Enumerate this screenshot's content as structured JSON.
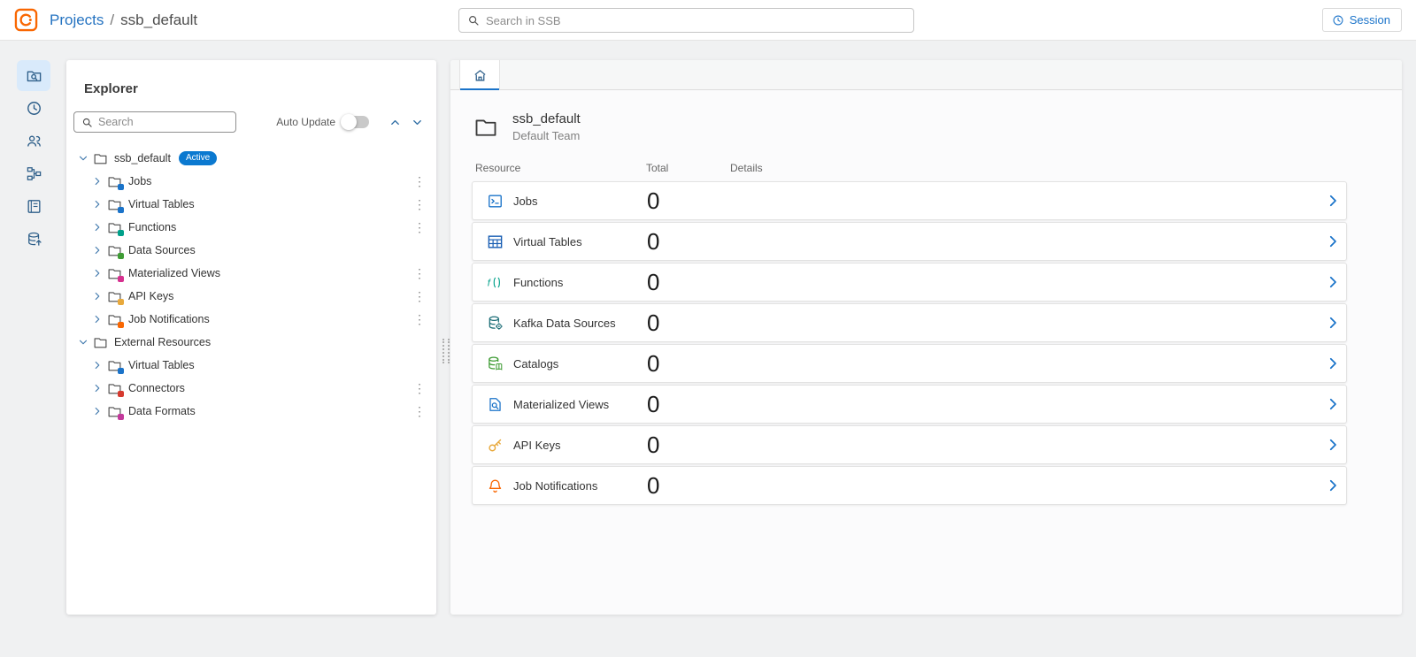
{
  "header": {
    "breadcrumb": {
      "projects": "Projects",
      "separator": "/",
      "current": "ssb_default"
    },
    "search": {
      "placeholder": "Search in SSB"
    },
    "session": {
      "label": "Session"
    }
  },
  "nav_rail": {
    "items": [
      {
        "id": "explorer",
        "icon": "folder-search-icon",
        "active": true
      },
      {
        "id": "history",
        "icon": "clock-icon",
        "active": false
      },
      {
        "id": "users",
        "icon": "users-icon",
        "active": false
      },
      {
        "id": "lineage",
        "icon": "flow-icon",
        "active": false
      },
      {
        "id": "docs",
        "icon": "notebook-icon",
        "active": false
      },
      {
        "id": "data",
        "icon": "database-icon",
        "active": false
      }
    ]
  },
  "explorer": {
    "title": "Explorer",
    "search": {
      "placeholder": "Search"
    },
    "auto_update": {
      "label": "Auto Update",
      "enabled": false
    },
    "tree": [
      {
        "label": "ssb_default",
        "level": 0,
        "expanded": true,
        "badge": "Active",
        "icon_color": null,
        "kebab": false
      },
      {
        "label": "Jobs",
        "level": 1,
        "expanded": false,
        "badge": null,
        "icon_color": "#1a73c9",
        "kebab": true
      },
      {
        "label": "Virtual Tables",
        "level": 1,
        "expanded": false,
        "badge": null,
        "icon_color": "#1a73c9",
        "kebab": true
      },
      {
        "label": "Functions",
        "level": 1,
        "expanded": false,
        "badge": null,
        "icon_color": "#00a08a",
        "kebab": true
      },
      {
        "label": "Data Sources",
        "level": 1,
        "expanded": false,
        "badge": null,
        "icon_color": "#3f9c35",
        "kebab": false
      },
      {
        "label": "Materialized Views",
        "level": 1,
        "expanded": false,
        "badge": null,
        "icon_color": "#d6308f",
        "kebab": true
      },
      {
        "label": "API Keys",
        "level": 1,
        "expanded": false,
        "badge": null,
        "icon_color": "#e8a93c",
        "kebab": true
      },
      {
        "label": "Job Notifications",
        "level": 1,
        "expanded": false,
        "badge": null,
        "icon_color": "#f96702",
        "kebab": true
      },
      {
        "label": "External Resources",
        "level": 0,
        "expanded": true,
        "badge": null,
        "icon_color": null,
        "kebab": false
      },
      {
        "label": "Virtual Tables",
        "level": 1,
        "expanded": false,
        "badge": null,
        "icon_color": "#1a73c9",
        "kebab": false
      },
      {
        "label": "Connectors",
        "level": 1,
        "expanded": false,
        "badge": null,
        "icon_color": "#d63a2f",
        "kebab": true
      },
      {
        "label": "Data Formats",
        "level": 1,
        "expanded": false,
        "badge": null,
        "icon_color": "#c2399b",
        "kebab": true
      }
    ]
  },
  "main": {
    "tabs": [
      {
        "id": "home",
        "icon": "home-icon",
        "active": true
      }
    ],
    "project": {
      "name": "ssb_default",
      "team": "Default Team"
    },
    "resource_table": {
      "columns": [
        "Resource",
        "Total",
        "Details"
      ],
      "rows": [
        {
          "icon": "jobs-icon",
          "color": "#1a73c9",
          "label": "Jobs",
          "total": "0"
        },
        {
          "icon": "virtual-tables-icon",
          "color": "#1a5fb4",
          "label": "Virtual Tables",
          "total": "0"
        },
        {
          "icon": "functions-icon",
          "color": "#00a08a",
          "label": "Functions",
          "total": "0"
        },
        {
          "icon": "kafka-icon",
          "color": "#1b6d76",
          "label": "Kafka Data Sources",
          "total": "0"
        },
        {
          "icon": "catalogs-icon",
          "color": "#3f9c35",
          "label": "Catalogs",
          "total": "0"
        },
        {
          "icon": "materialized-views-icon",
          "color": "#1a73c9",
          "label": "Materialized Views",
          "total": "0"
        },
        {
          "icon": "api-keys-icon",
          "color": "#e8a93c",
          "label": "API Keys",
          "total": "0"
        },
        {
          "icon": "bell-icon",
          "color": "#f96702",
          "label": "Job Notifications",
          "total": "0"
        }
      ]
    }
  },
  "colors": {
    "brand_orange": "#f96702",
    "link_blue": "#2573c1",
    "accent_blue": "#1a73c9",
    "active_badge": "#0b79d0",
    "rail_icon": "#2e5f8a"
  }
}
